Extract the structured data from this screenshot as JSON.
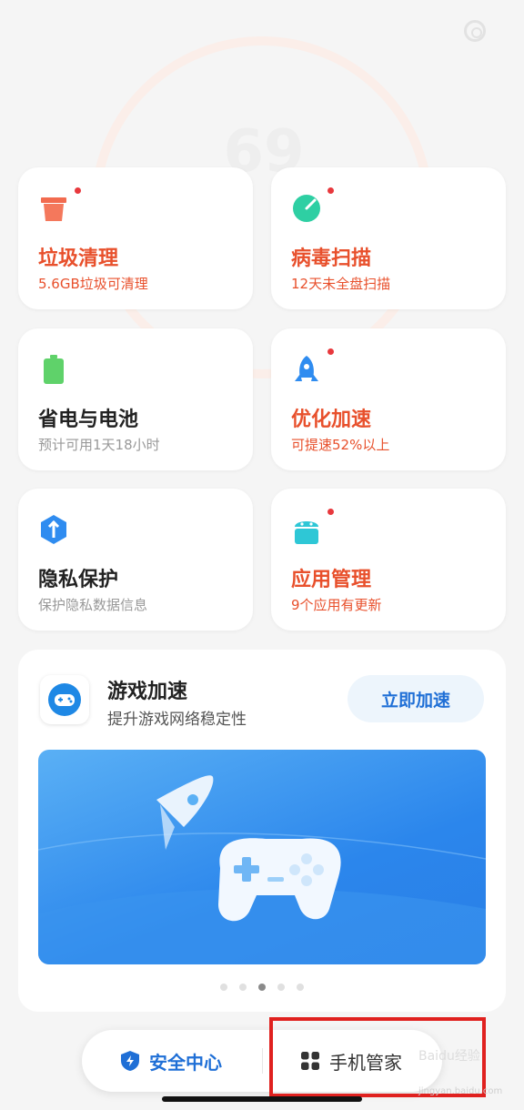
{
  "background": {
    "score": "69"
  },
  "cards": [
    {
      "title": "垃圾清理",
      "subtitle": "5.6GB垃圾可清理",
      "icon": "trash-icon",
      "alert": true,
      "emphasis": "red"
    },
    {
      "title": "病毒扫描",
      "subtitle": "12天未全盘扫描",
      "icon": "virus-scan-icon",
      "alert": true,
      "emphasis": "red"
    },
    {
      "title": "省电与电池",
      "subtitle": "预计可用1天18小时",
      "icon": "battery-icon",
      "alert": false,
      "emphasis": "normal"
    },
    {
      "title": "优化加速",
      "subtitle": "可提速52%以上",
      "icon": "rocket-icon",
      "alert": true,
      "emphasis": "red"
    },
    {
      "title": "隐私保护",
      "subtitle": "保护隐私数据信息",
      "icon": "privacy-shield-icon",
      "alert": false,
      "emphasis": "normal"
    },
    {
      "title": "应用管理",
      "subtitle": "9个应用有更新",
      "icon": "android-app-icon",
      "alert": true,
      "emphasis": "red"
    }
  ],
  "game": {
    "title": "游戏加速",
    "subtitle": "提升游戏网络稳定性",
    "button": "立即加速",
    "carousel_total": 5,
    "carousel_active": 3
  },
  "nav": {
    "security": "安全中心",
    "manager": "手机管家"
  },
  "watermark": {
    "line1": "Baidu经验",
    "line2": "jingyan.baidu.com"
  },
  "colors": {
    "accent_red": "#e8502c",
    "accent_blue": "#1f6fd6",
    "highlight": "#e0211f"
  }
}
